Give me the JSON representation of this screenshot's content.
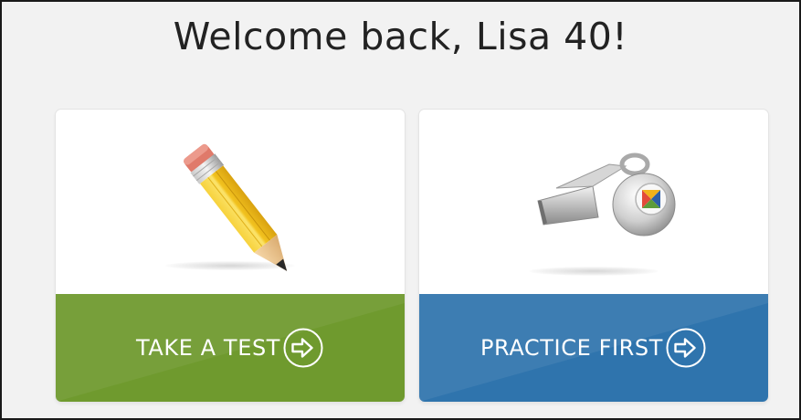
{
  "page": {
    "greeting": "Welcome back, Lisa 40!"
  },
  "cards": [
    {
      "id": "take-test",
      "label": "TAKE A TEST",
      "icon": "pencil-icon",
      "action_icon": "arrow-right-circle-icon",
      "color": "#6f9a2e"
    },
    {
      "id": "practice-first",
      "label": "PRACTICE FIRST",
      "icon": "whistle-icon",
      "action_icon": "arrow-right-circle-icon",
      "color": "#2f74ad"
    }
  ],
  "colors": {
    "background": "#f2f2f2",
    "frame_border": "#1a1a1a",
    "text": "#222222",
    "test_green": "#6f9a2e",
    "practice_blue": "#2f74ad"
  }
}
